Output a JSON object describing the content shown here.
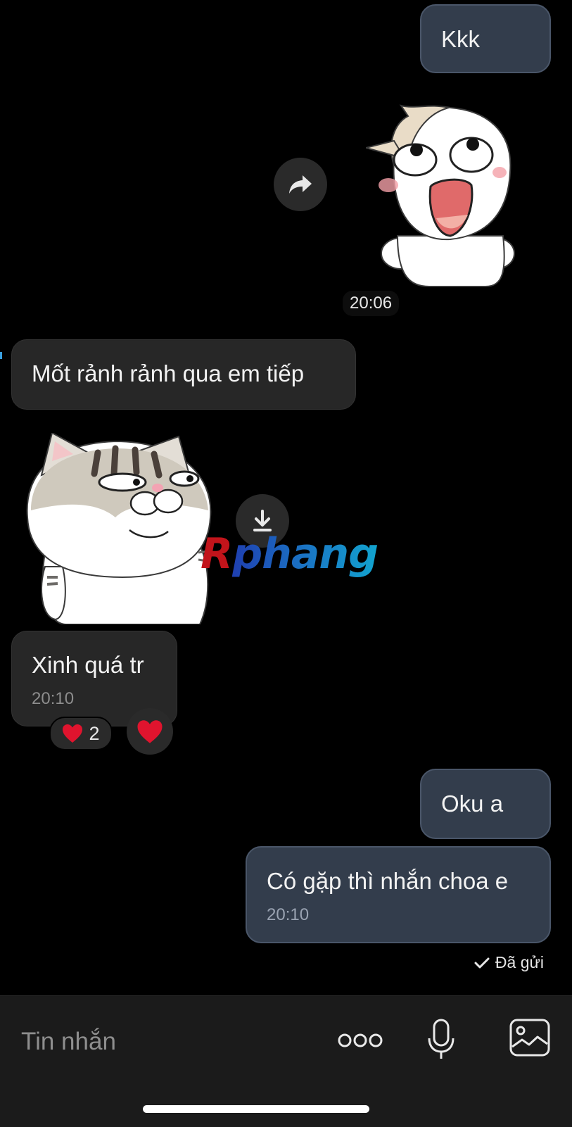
{
  "messages": {
    "m1": {
      "text": "Kkk"
    },
    "sticker1": {
      "name": "white cat sticker",
      "time": "20:06"
    },
    "m2": {
      "text": "Mốt rảnh rảnh qua em tiếp"
    },
    "sticker2": {
      "name": "grey tabby cat sticker"
    },
    "m3": {
      "text": "Xinh quá tr",
      "time": "20:10",
      "reaction_count": "2"
    },
    "m4": {
      "text": "Oku a"
    },
    "m5": {
      "text": "Có gặp thì nhắn choa e",
      "time": "20:10"
    }
  },
  "watermark": {
    "first": "R",
    "rest": "phang"
  },
  "status": {
    "text": "Đã gửi"
  },
  "composer": {
    "placeholder": "Tin nhắn"
  },
  "icons": {
    "forward": "forward-icon",
    "download": "download-icon",
    "heart": "heart-icon",
    "more": "more-icon",
    "mic": "microphone-icon",
    "image": "image-icon",
    "check": "check-icon"
  },
  "colors": {
    "background": "#000000",
    "outgoing_bubble": "#333d4c",
    "incoming_bubble": "#272727",
    "heart": "#e0142e",
    "watermark_red": "#c2141b",
    "watermark_blue": "#1a74c4"
  }
}
